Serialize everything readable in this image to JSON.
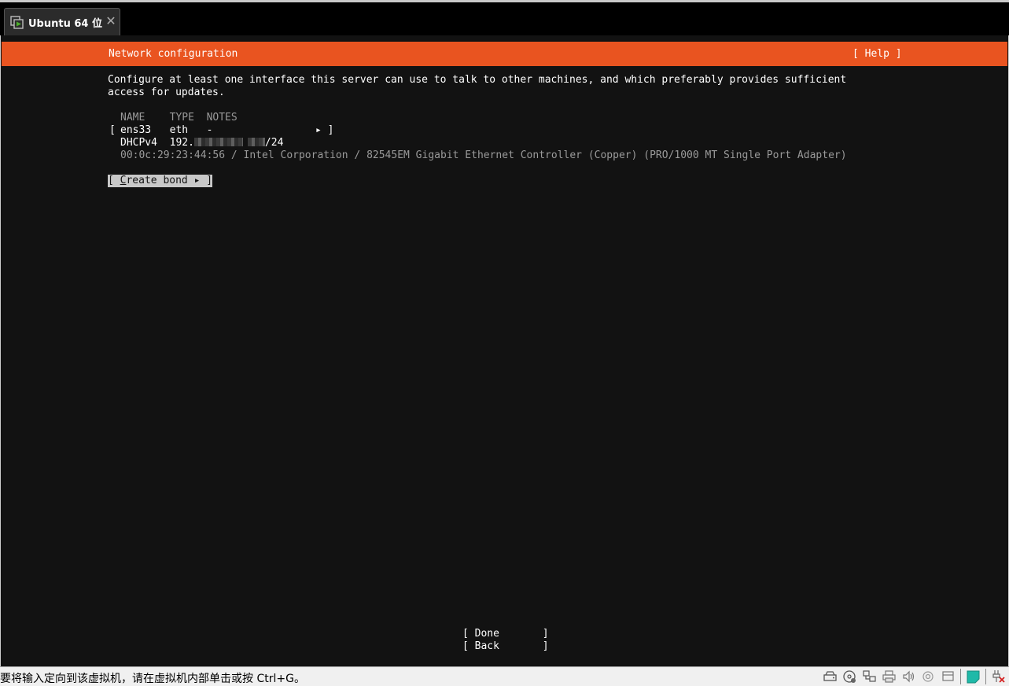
{
  "window": {
    "tab_title": "Ubuntu 64 位",
    "tab_icon": "vm-play-icon",
    "close_icon": "close-icon"
  },
  "installer": {
    "header_title": "Network configuration",
    "help_label": "[ Help ]",
    "intro_line1": "Configure at least one interface this server can use to talk to other machines, and which preferably provides sufficient",
    "intro_line2": "access for updates.",
    "table_header": "NAME    TYPE  NOTES",
    "interface": {
      "open_bracket": "[",
      "row": "ens33   eth   -",
      "arrow": "▸ ]",
      "dhcp_label": "DHCPv4  192.",
      "dhcp_suffix": "/24",
      "details": "00:0c:29:23:44:56 / Intel Corporation / 82545EM Gigabit Ethernet Controller (Copper) (PRO/1000 MT Single Port Adapter)"
    },
    "create_bond": {
      "open": "[ ",
      "accel": "C",
      "rest": "reate bond ▸ ]"
    },
    "done_label": "[ Done       ]",
    "back_label": "[ Back       ]"
  },
  "statusbar": {
    "message": "要将输入定向到该虚拟机，请在虚拟机内部单击或按 Ctrl+G。",
    "icons": [
      "hard-disk-icon",
      "cd-dvd-icon",
      "network-adapter-icon",
      "printer-icon",
      "sound-icon",
      "usb-icon",
      "display-icon",
      "message-icon",
      "disconnected-icon"
    ]
  },
  "colors": {
    "ubuntu_orange": "#e95420",
    "console_bg": "#121212",
    "selected_bg": "#c8c8c8"
  }
}
